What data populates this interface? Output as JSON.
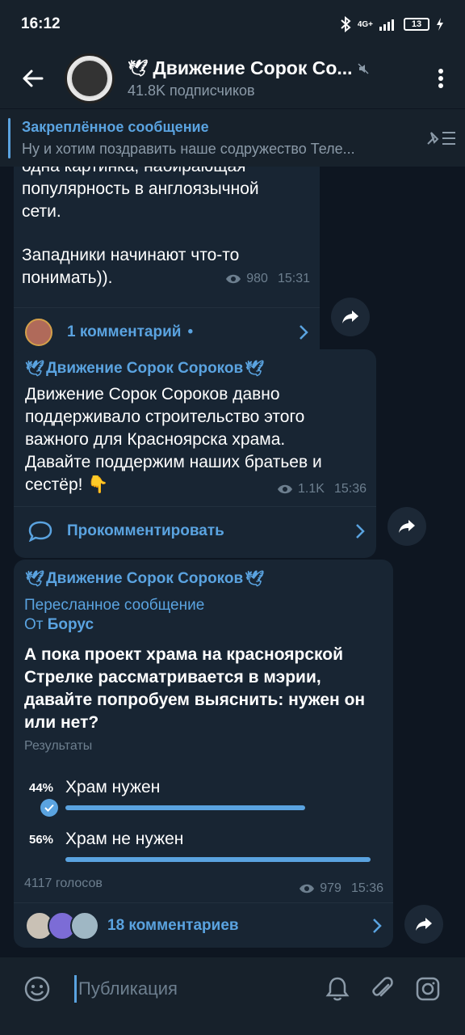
{
  "status": {
    "time": "16:12",
    "network": "4G+",
    "battery": "13"
  },
  "header": {
    "dove": "🕊",
    "title": "Движение Сорок Со...",
    "subscribers": "41.8K подписчиков"
  },
  "pinned": {
    "title": "Закреплённое сообщение",
    "text": "Ну и хотим поздравить наше содружество Теле..."
  },
  "messages": [
    {
      "lines": [
        "одна картинка, набирающая",
        "популярность в англоязычной",
        "сети."
      ],
      "lines2": [
        "Западники начинают что-то",
        "понимать))."
      ],
      "views": "980",
      "time": "15:31",
      "comments": "1 комментарий",
      "dot": "•"
    },
    {
      "channel": "Движение Сорок Сороков",
      "lines": [
        "Движение Сорок Сороков давно",
        "поддерживало строительство этого",
        "важного для Красноярска храма.",
        "Давайте поддержим наших братьев и",
        "сестёр! 👇"
      ],
      "views": "1.1K",
      "time": "15:36",
      "comments": "Прокомментировать"
    },
    {
      "channel": "Движение Сорок Сороков",
      "forwarded": "Пересланное сообщение",
      "from_label": "От",
      "from_name": "Борус",
      "question_lines": [
        "А пока проект храма на красноярской",
        "Стрелке рассматривается в мэрии,",
        "давайте попробуем выяснить: нужен он",
        "или нет?"
      ],
      "results_label": "Результаты",
      "options": [
        {
          "percent": "44%",
          "label": "Храм нужен",
          "value": 44,
          "chosen": true
        },
        {
          "percent": "56%",
          "label": "Храм не нужен",
          "value": 56,
          "chosen": false
        }
      ],
      "votes": "4117 голосов",
      "views": "979",
      "time": "15:36",
      "comments": "18 комментариев"
    }
  ],
  "input": {
    "placeholder": "Публикация"
  },
  "colors": {
    "accent": "#5aa3e0",
    "bubble": "#182533",
    "background": "#0e1621",
    "bar": "#17212b"
  }
}
